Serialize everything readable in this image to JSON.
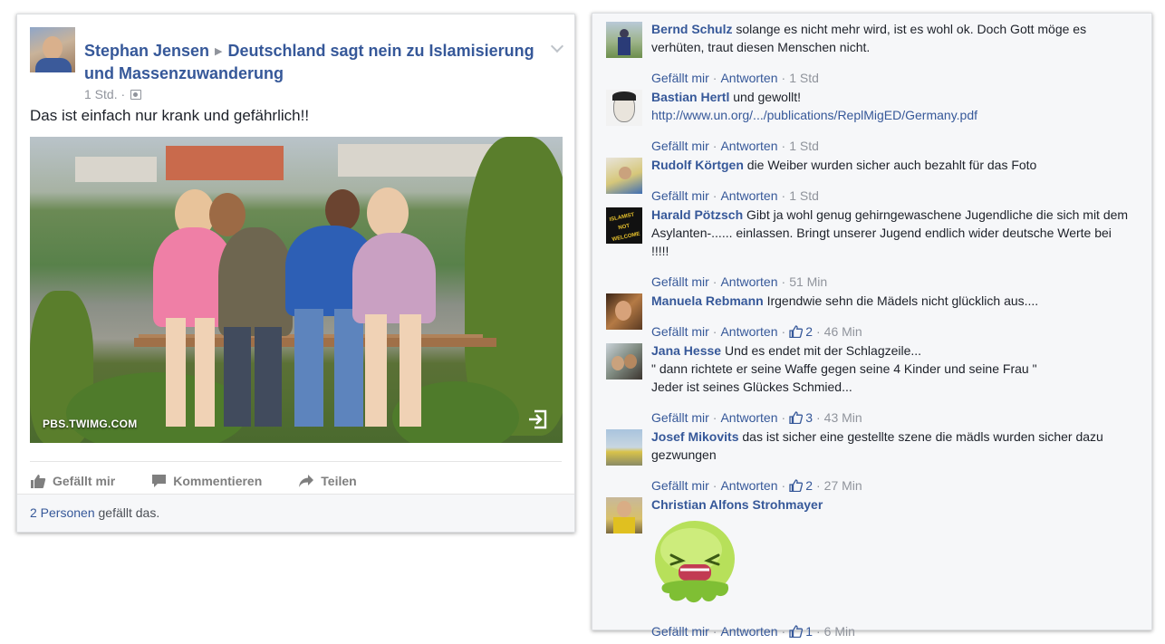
{
  "post": {
    "author": "Stephan Jensen",
    "group": "Deutschland sagt nein zu Islamisierung und Massenzuwanderung",
    "time": "1 Std.",
    "text": "Das ist einfach nur krank und gefährlich!!",
    "image_source": "PBS.TWIMG.COM",
    "actions": {
      "like": "Gefällt mir",
      "comment": "Kommentieren",
      "share": "Teilen"
    },
    "likes_link": "2 Personen",
    "likes_suffix": " gefällt das."
  },
  "comment_actions": {
    "like": "Gefällt mir",
    "reply": "Antworten",
    "separator": "·"
  },
  "comments": [
    {
      "author": "Bernd Schulz",
      "text": "solange es nicht mehr wird, ist es wohl ok. Doch Gott möge es verhüten, traut diesen Menschen nicht.",
      "likes": "",
      "time": "1 Std"
    },
    {
      "author": "Bastian Hertl",
      "text": "und gewollt!",
      "link": "http://www.un.org/.../publications/ReplMigED/Germany.pdf",
      "likes": "",
      "time": "1 Std"
    },
    {
      "author": "Rudolf Körtgen",
      "text": "die Weiber wurden sicher auch bezahlt für das Foto",
      "likes": "",
      "time": "1 Std"
    },
    {
      "author": "Harald Pötzsch",
      "text": "Gibt ja wohl genug gehirngewaschene Jugendliche die sich mit dem Asylanten-...... einlassen. Bringt unserer Jugend endlich wider deutsche Werte bei !!!!!",
      "likes": "",
      "time": "51 Min",
      "avatar_text": "ISLAMIST NOT WELCOME"
    },
    {
      "author": "Manuela Rebmann",
      "text": "Irgendwie sehn die Mädels nicht glücklich aus....",
      "likes": "2",
      "time": "46 Min"
    },
    {
      "author": "Jana Hesse",
      "text": "Und es endet mit der Schlagzeile...",
      "line2": "\" dann richtete er seine Waffe gegen seine 4 Kinder und seine Frau \"",
      "line3": "Jeder ist seines Glückes Schmied...",
      "likes": "3",
      "time": "43 Min"
    },
    {
      "author": "Josef Mikovits",
      "text": "das ist sicher eine gestellte szene die mädls wurden sicher dazu gezwungen",
      "likes": "2",
      "time": "27 Min"
    },
    {
      "author": "Christian Alfons Strohmayer",
      "text": "",
      "likes": "1",
      "time": "6 Min"
    }
  ],
  "colors": {
    "link": "#365899",
    "meta": "#90949c",
    "panel_bg": "#f6f7f9",
    "sticker_green": "#9fd44a"
  }
}
